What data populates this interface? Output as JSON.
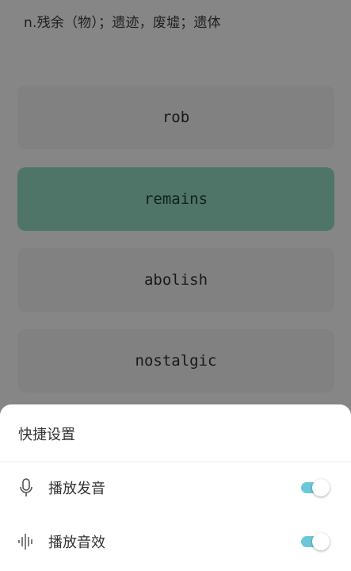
{
  "quiz": {
    "definition": "n.残余（物）；遗迹，废墟；遗体",
    "options": [
      "rob",
      "remains",
      "abolish",
      "nostalgic"
    ],
    "selected_index": 1,
    "selected_color": "#8fd6bc"
  },
  "quick_settings": {
    "title": "快捷设置",
    "items": [
      {
        "label": "播放发音",
        "icon": "microphone-icon",
        "enabled": true
      },
      {
        "label": "播放音效",
        "icon": "sound-wave-icon",
        "enabled": true
      }
    ],
    "toggle_color": "#6cc7d9"
  }
}
